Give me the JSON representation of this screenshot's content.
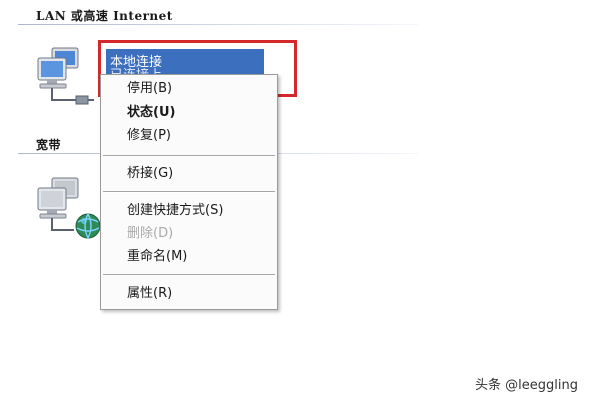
{
  "groups": {
    "lan_title": "LAN 或高速 Internet",
    "broadband_title": "宽带"
  },
  "connection": {
    "name": "本地连接",
    "status": "已连接上"
  },
  "context_menu": {
    "items": [
      {
        "label": "停用(B)",
        "bold": false,
        "disabled": false
      },
      {
        "label": "状态(U)",
        "bold": true,
        "disabled": false
      },
      {
        "label": "修复(P)",
        "bold": false,
        "disabled": false
      },
      {
        "label": "桥接(G)",
        "bold": false,
        "disabled": false
      },
      {
        "label": "创建快捷方式(S)",
        "bold": false,
        "disabled": false
      },
      {
        "label": "删除(D)",
        "bold": false,
        "disabled": true
      },
      {
        "label": "重命名(M)",
        "bold": false,
        "disabled": false
      },
      {
        "label": "属性(R)",
        "bold": false,
        "disabled": false
      }
    ]
  },
  "highlight_color": "#d4282a",
  "selection_color": "#3d6fbf",
  "watermark": "头条 @leeggling",
  "icons": [
    "lan-connection-icon",
    "broadband-connection-icon"
  ]
}
